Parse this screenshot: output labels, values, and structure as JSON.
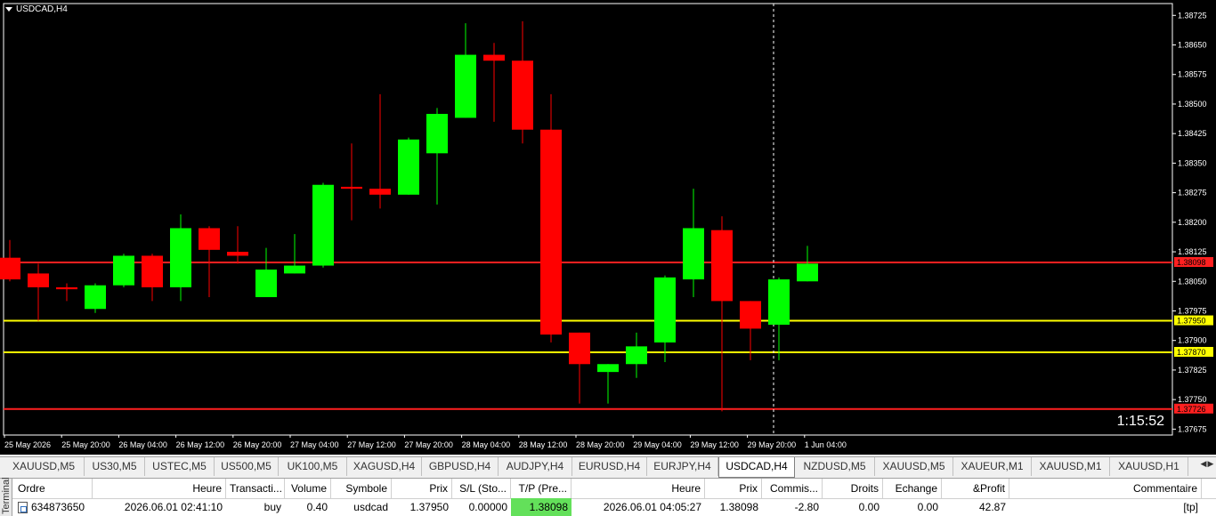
{
  "chart": {
    "symbol_label": "USDCAD,H4",
    "countdown": "1:15:52",
    "price_axis": [
      "1.38725",
      "1.38650",
      "1.38575",
      "1.38500",
      "1.38425",
      "1.38350",
      "1.38275",
      "1.38200",
      "1.38125",
      "1.38050",
      "1.37975",
      "1.37900",
      "1.37825",
      "1.37750",
      "1.37675"
    ],
    "time_axis": [
      "25 May 2026",
      "25 May 20:00",
      "26 May 04:00",
      "26 May 12:00",
      "26 May 20:00",
      "27 May 04:00",
      "27 May 12:00",
      "27 May 20:00",
      "28 May 04:00",
      "28 May 12:00",
      "28 May 20:00",
      "29 May 04:00",
      "29 May 12:00",
      "29 May 20:00",
      "1 Jun 04:00"
    ],
    "levels": [
      {
        "price": 1.38098,
        "label": "1.38098",
        "color": "#ff2020",
        "tag_bg": "#ff2020",
        "tag_fg": "#000000"
      },
      {
        "price": 1.3795,
        "label": "1.37950",
        "color": "#ffff00",
        "tag_bg": "#ffff00",
        "tag_fg": "#000000"
      },
      {
        "price": 1.3787,
        "label": "1.37870",
        "color": "#ffff00",
        "tag_bg": "#ffff00",
        "tag_fg": "#000000"
      },
      {
        "price": 1.37726,
        "label": "1.37726",
        "color": "#ff2020",
        "tag_bg": "#ff2020",
        "tag_fg": "#000000"
      }
    ],
    "bull_color": "#00ff00",
    "bear_color": "#ff0000",
    "candles": [
      {
        "o": 1.3811,
        "h": 1.38155,
        "l": 1.3805,
        "c": 1.38055
      },
      {
        "o": 1.3807,
        "h": 1.38095,
        "l": 1.3795,
        "c": 1.38035
      },
      {
        "o": 1.38035,
        "h": 1.38045,
        "l": 1.38,
        "c": 1.3803
      },
      {
        "o": 1.3798,
        "h": 1.38045,
        "l": 1.3797,
        "c": 1.3804
      },
      {
        "o": 1.3804,
        "h": 1.3812,
        "l": 1.38035,
        "c": 1.38115
      },
      {
        "o": 1.38115,
        "h": 1.3812,
        "l": 1.38,
        "c": 1.38035
      },
      {
        "o": 1.38035,
        "h": 1.3822,
        "l": 1.38,
        "c": 1.38185
      },
      {
        "o": 1.38185,
        "h": 1.3819,
        "l": 1.3801,
        "c": 1.3813
      },
      {
        "o": 1.38125,
        "h": 1.3819,
        "l": 1.38095,
        "c": 1.38115
      },
      {
        "o": 1.3801,
        "h": 1.38135,
        "l": 1.3801,
        "c": 1.3808
      },
      {
        "o": 1.3807,
        "h": 1.3817,
        "l": 1.3807,
        "c": 1.3809
      },
      {
        "o": 1.3809,
        "h": 1.383,
        "l": 1.38085,
        "c": 1.38295
      },
      {
        "o": 1.3829,
        "h": 1.384,
        "l": 1.38205,
        "c": 1.38285
      },
      {
        "o": 1.38285,
        "h": 1.38525,
        "l": 1.38235,
        "c": 1.3827
      },
      {
        "o": 1.3827,
        "h": 1.38415,
        "l": 1.3827,
        "c": 1.3841
      },
      {
        "o": 1.38375,
        "h": 1.3849,
        "l": 1.38245,
        "c": 1.38475
      },
      {
        "o": 1.38465,
        "h": 1.38705,
        "l": 1.38465,
        "c": 1.38625
      },
      {
        "o": 1.38625,
        "h": 1.38655,
        "l": 1.38455,
        "c": 1.3861
      },
      {
        "o": 1.3861,
        "h": 1.3871,
        "l": 1.384,
        "c": 1.38435
      },
      {
        "o": 1.38435,
        "h": 1.38525,
        "l": 1.37895,
        "c": 1.37915
      },
      {
        "o": 1.3792,
        "h": 1.3792,
        "l": 1.3774,
        "c": 1.3784
      },
      {
        "o": 1.3782,
        "h": 1.3784,
        "l": 1.3774,
        "c": 1.3784
      },
      {
        "o": 1.3784,
        "h": 1.3792,
        "l": 1.37805,
        "c": 1.37885
      },
      {
        "o": 1.37895,
        "h": 1.38065,
        "l": 1.37845,
        "c": 1.3806
      },
      {
        "o": 1.38055,
        "h": 1.38285,
        "l": 1.3801,
        "c": 1.38185
      },
      {
        "o": 1.3818,
        "h": 1.38215,
        "l": 1.3772,
        "c": 1.38
      },
      {
        "o": 1.38,
        "h": 1.38,
        "l": 1.3785,
        "c": 1.3793
      },
      {
        "o": 1.3794,
        "h": 1.3806,
        "l": 1.3785,
        "c": 1.38055
      },
      {
        "o": 1.3805,
        "h": 1.3814,
        "l": 1.3805,
        "c": 1.38095
      }
    ],
    "price_top": 1.38755,
    "price_bottom": 1.3766
  },
  "tabs": [
    "XAUUSD,M5",
    "US30,M5",
    "USTEC,M5",
    "US500,M5",
    "UK100,M5",
    "XAGUSD,H4",
    "GBPUSD,H4",
    "AUDJPY,H4",
    "EURUSD,H4",
    "EURJPY,H4",
    "USDCAD,H4",
    "NZDUSD,M5",
    "XAUUSD,M5",
    "XAUEUR,M1",
    "XAUUSD,M1",
    "XAUUSD,H1"
  ],
  "active_tab": "USDCAD,H4",
  "terminal": {
    "side_label": "Terminal",
    "headers": [
      "Ordre",
      "Heure",
      "Transacti...",
      "Volume",
      "Symbole",
      "Prix",
      "S/L (Sto...",
      "T/P (Pre...",
      "Heure",
      "Prix",
      "Commis...",
      "Droits",
      "Echange",
      "&Profit",
      "Commentaire"
    ],
    "row": [
      "634873650",
      "2026.06.01 02:41:10",
      "buy",
      "0.40",
      "usdcad",
      "1.37950",
      "0.00000",
      "1.38098",
      "2026.06.01 04:05:27",
      "1.38098",
      "-2.80",
      "0.00",
      "0.00",
      "42.87",
      "[tp]"
    ]
  }
}
